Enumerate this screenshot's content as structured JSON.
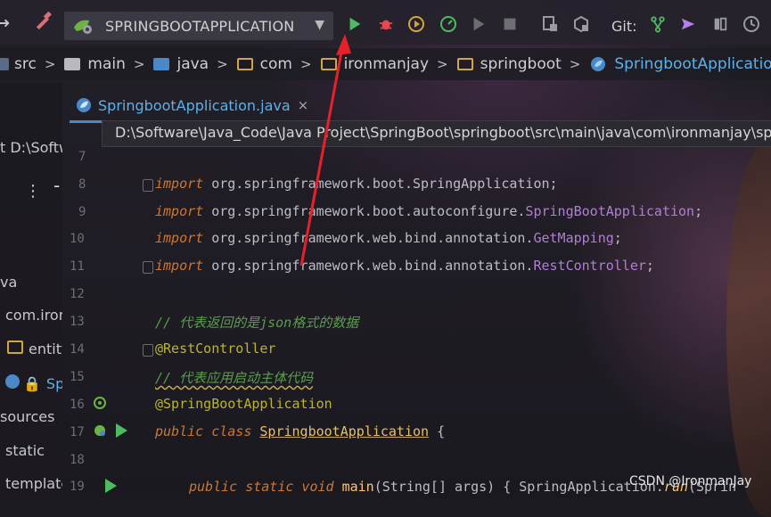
{
  "toolbar": {
    "run_config": "SPRINGBOOTAPPLICATION",
    "git_label": "Git:"
  },
  "breadcrumb": {
    "items": [
      "src",
      "main",
      "java",
      "com",
      "ironmanjay",
      "springboot",
      "SpringbootApplication"
    ]
  },
  "sidebar": {
    "rows": [
      "t D:\\Softw",
      "va",
      "com.iron",
      "entity",
      "Sp",
      "sources",
      "static",
      "template"
    ]
  },
  "tab": {
    "label": "SpringbootApplication.java",
    "close": "×"
  },
  "path_tooltip": "D:\\Software\\Java_Code\\Java Project\\SpringBoot\\springboot\\src\\main\\java\\com\\ironmanjay\\sp",
  "editor": {
    "line_numbers": [
      "7",
      "8",
      "9",
      "10",
      "11",
      "12",
      "13",
      "14",
      "15",
      "16",
      "17",
      "18",
      "19"
    ],
    "import_kw": "import",
    "imports": [
      {
        "pkg": "org.springframework.boot.",
        "cls": "SpringApplication",
        "tail": ";"
      },
      {
        "pkg": "org.springframework.boot.autoconfigure.",
        "cls": "SpringBootApplication",
        "tail": ";"
      },
      {
        "pkg": "org.springframework.web.bind.annotation.",
        "cls": "GetMapping",
        "tail": ";"
      },
      {
        "pkg": "org.springframework.web.bind.annotation.",
        "cls": "RestController",
        "tail": ";"
      }
    ],
    "comment1": "// 代表返回的是json格式的数据",
    "annotation1": "@RestController",
    "comment2": "// 代表应用启动主体代码",
    "annotation2": "@SpringBootApplication",
    "class_kw": "public class",
    "class_name": "SpringbootApplication",
    "class_open": " {",
    "main_kw": "public static void",
    "main_name": "main",
    "main_params": "(String[] args) { SpringApplication.",
    "main_run": "run",
    "main_tail": "(Sprin"
  },
  "watermark": "CSDN @IronmanJay",
  "colors": {
    "accent_blue": "#5fb0e8",
    "run_green": "#4dbb5f",
    "arrow_red": "#e8202a"
  }
}
